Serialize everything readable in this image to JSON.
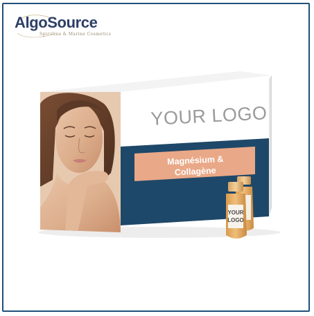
{
  "brand": {
    "name": "AlgoSource",
    "tagline": "Spirulina & Marine Cosmetics"
  },
  "product": {
    "box_logo_placeholder": "YOUR LOGO",
    "label_line1": "Magnésium &",
    "label_line2": "Collagène",
    "vial_label_line1": "YOUR",
    "vial_label_line2": "LOGO"
  },
  "colors": {
    "frame": "#1f4f7a",
    "box_navy": "#1e4869",
    "label_peach": "#e9a887",
    "vial_liquid": "#e3a85a"
  }
}
